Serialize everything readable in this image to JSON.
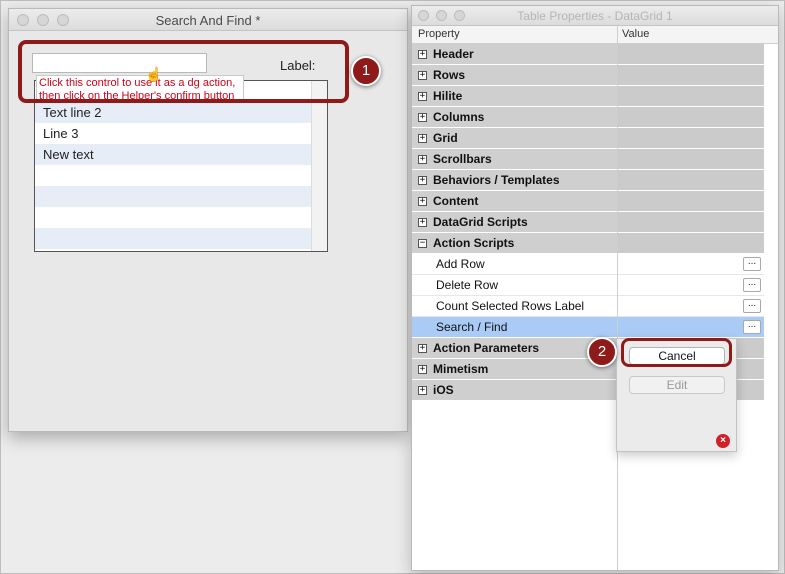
{
  "left_window": {
    "title": "Search And Find *",
    "label_text": "Label:",
    "search_field": {
      "value": "",
      "placeholder": ""
    },
    "tooltip": {
      "line1": "Click this control to use it as a dg action,",
      "line2": "then click on the Helper's confirm button"
    },
    "grid_rows": [
      "",
      "Text line 2",
      "Line 3",
      "New text",
      "",
      "",
      "",
      ""
    ]
  },
  "right_window": {
    "title": "Table Properties - DataGrid 1",
    "columns": {
      "property": "Property",
      "value": "Value"
    },
    "groups": {
      "header": "Header",
      "rows": "Rows",
      "hilite": "Hilite",
      "columns": "Columns",
      "grid": "Grid",
      "scrollbars": "Scrollbars",
      "behaviors": "Behaviors / Templates",
      "content": "Content",
      "datagrid_scripts": "DataGrid Scripts",
      "action_scripts": "Action Scripts",
      "action_parameters": "Action Parameters",
      "mimetism": "Mimetism",
      "ios": "iOS"
    },
    "action_items": {
      "add_row": "Add Row",
      "delete_row": "Delete Row",
      "count_selected": "Count Selected Rows Label",
      "search_find": "Search / Find"
    },
    "toggle_plus": "+",
    "toggle_minus": "−",
    "ellipsis": "..."
  },
  "popup": {
    "cancel_label": "Cancel",
    "edit_label": "Edit",
    "delete_icon": "×"
  },
  "callouts": {
    "one": "1",
    "two": "2"
  },
  "colors": {
    "callout": "#8e1a1a",
    "selection": "#a9cbf6",
    "tooltip_text": "#d0021b"
  }
}
